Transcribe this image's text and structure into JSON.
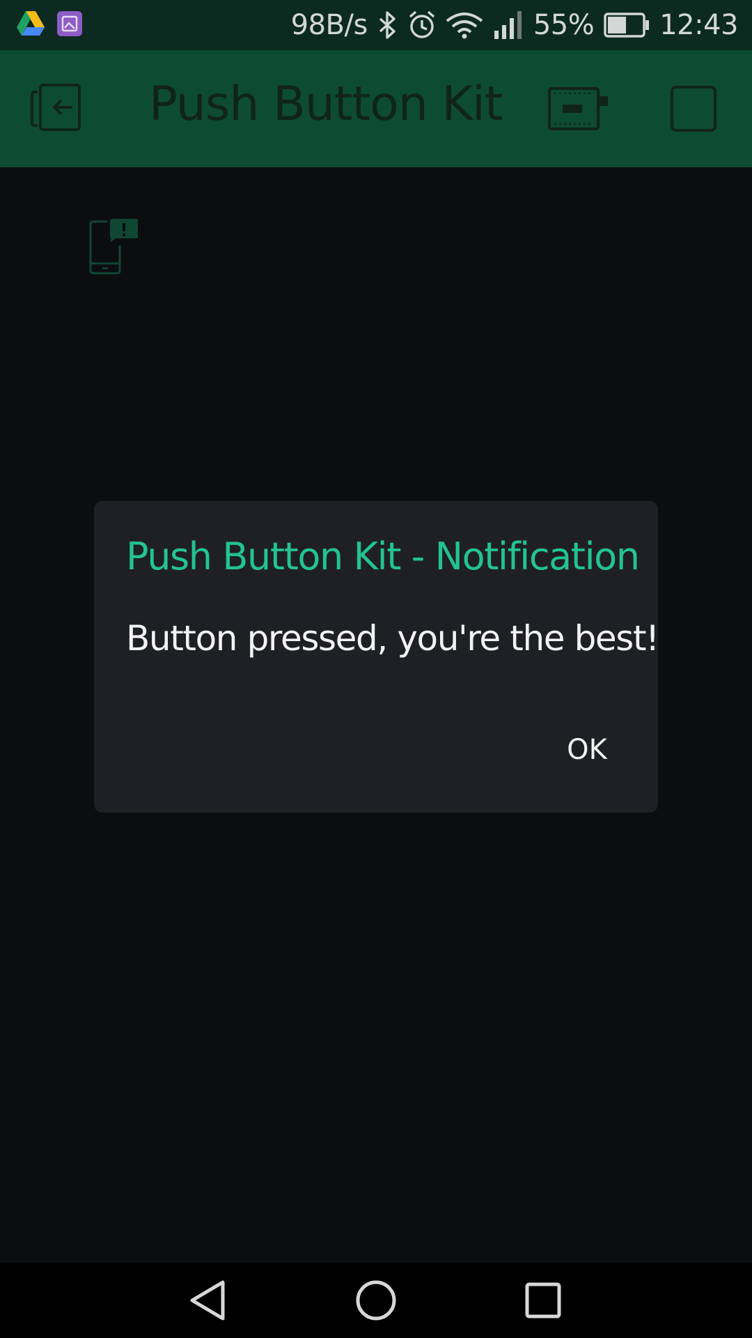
{
  "status_bar": {
    "net_speed": "98B/s",
    "battery": "55%",
    "time": "12:43",
    "battery_level": 0.55,
    "icons": [
      "drive-icon",
      "gallery-icon",
      "bluetooth-icon",
      "alarm-icon",
      "wifi-icon",
      "signal-icon",
      "battery-icon"
    ]
  },
  "app_bar": {
    "title": "Push Button Kit",
    "icons": [
      "back-to-list-icon",
      "device-icon",
      "stop-square-icon"
    ]
  },
  "widget": {
    "icon": "notification-widget-icon"
  },
  "dialog": {
    "title": "Push Button Kit - Notification",
    "message": "Button pressed, you're the best!",
    "ok_label": "OK"
  },
  "nav_bar": {
    "icons": [
      "nav-back-icon",
      "nav-home-icon",
      "nav-recent-icon"
    ]
  },
  "colors": {
    "status_bar_bg": "#0d2a20",
    "app_bar_bg": "#0e4b34",
    "accent": "#23c48e",
    "dialog_bg": "#1f2023",
    "background": "#0c0d0f"
  }
}
